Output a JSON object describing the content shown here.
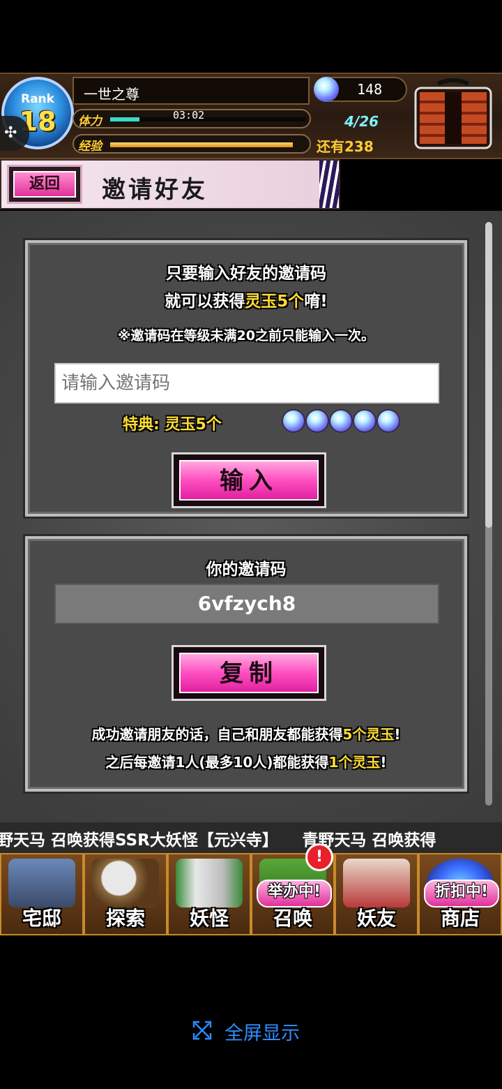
{
  "header": {
    "rank_label": "Rank",
    "rank_value": "18",
    "player_name": "一世之尊",
    "stamina_label": "体力",
    "stamina_timer": "03:02",
    "stamina_count": "4/26",
    "stamina_fill": 0.15,
    "exp_label": "经验",
    "exp_remaining": "还有238",
    "exp_fill": 0.95,
    "gem_count": "148"
  },
  "title_bar": {
    "back_label": "返回",
    "title": "邀请好友"
  },
  "invite_panel": {
    "intro_line1": "只要输入好友的邀请码",
    "intro_line2_prefix": "就可以获得",
    "intro_line2_highlight": "灵玉5个",
    "intro_line2_suffix": "唷!",
    "note": "※邀请码在等级未满20之前只能输入一次。",
    "input_placeholder": "请输入邀请码",
    "bonus_label": "特典: 灵玉5个",
    "bonus_gem_count": 5,
    "enter_button": "输入"
  },
  "my_code_panel": {
    "title": "你的邀请码",
    "code": "6vfzych8",
    "copy_button": "复制",
    "reward_line1_prefix": "成功邀请朋友的话，自己和朋友都能获得",
    "reward_line1_highlight": "5个灵玉",
    "reward_line1_suffix": "!",
    "reward_line2_prefix": "之后每邀请1人(最多10人)都能获得",
    "reward_line2_highlight": "1个灵玉",
    "reward_line2_suffix": "!"
  },
  "ticker": {
    "text": "野天马 召唤获得SSR大妖怪【元兴寺】　　青野天马 召唤获得"
  },
  "bottom_nav": {
    "items": [
      {
        "label": "宅邸",
        "icon": "mansion-icon"
      },
      {
        "label": "探索",
        "icon": "magnifier-map-icon"
      },
      {
        "label": "妖怪",
        "icon": "yokai-scroll-icon"
      },
      {
        "label": "召唤",
        "icon": "summon-scroll-icon",
        "badge": "举办中!"
      },
      {
        "label": "妖友",
        "icon": "fox-girl-icon"
      },
      {
        "label": "商店",
        "icon": "orb-shop-icon",
        "badge": "折扣中!"
      }
    ],
    "alert_badge": "!"
  },
  "footer": {
    "fullscreen_label": "全屏显示"
  },
  "colors": {
    "accent_pink": "#ff4fc0",
    "highlight_gold": "#ffdd33",
    "link_blue": "#2f8cff",
    "panel_gray": "#4a4a4a"
  }
}
